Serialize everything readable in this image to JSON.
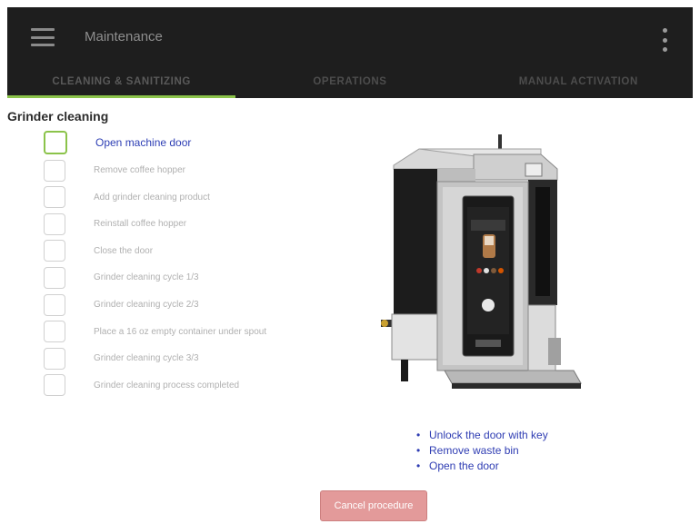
{
  "app": {
    "title": "Maintenance"
  },
  "tabs": [
    {
      "label": "CLEANING & SANITIZING",
      "active": true
    },
    {
      "label": "OPERATIONS",
      "active": false
    },
    {
      "label": "MANUAL ACTIVATION",
      "active": false
    }
  ],
  "section": {
    "title": "Grinder cleaning"
  },
  "steps": [
    {
      "label": "Open machine door",
      "active": true
    },
    {
      "label": "Remove coffee hopper",
      "active": false
    },
    {
      "label": "Add grinder cleaning product",
      "active": false
    },
    {
      "label": "Reinstall coffee hopper",
      "active": false
    },
    {
      "label": "Close the door",
      "active": false
    },
    {
      "label": "Grinder cleaning cycle 1/3",
      "active": false
    },
    {
      "label": "Grinder cleaning cycle 2/3",
      "active": false
    },
    {
      "label": "Place a 16 oz empty container under spout",
      "active": false
    },
    {
      "label": "Grinder cleaning cycle 3/3",
      "active": false
    },
    {
      "label": "Grinder cleaning process completed",
      "active": false
    }
  ],
  "instructions": [
    "Unlock the door with key",
    "Remove waste bin",
    "Open the door"
  ],
  "actions": {
    "cancel_label": "Cancel procedure"
  },
  "colors": {
    "accent_green": "#8bc34a",
    "active_text_blue": "#2d3eb4",
    "cancel_red": "#e39a9a",
    "appbar_dark": "#1e1e1e"
  },
  "icons": {
    "menu": "hamburger-menu-icon",
    "more": "more-vert-icon",
    "machine": "coffee-machine-image"
  }
}
